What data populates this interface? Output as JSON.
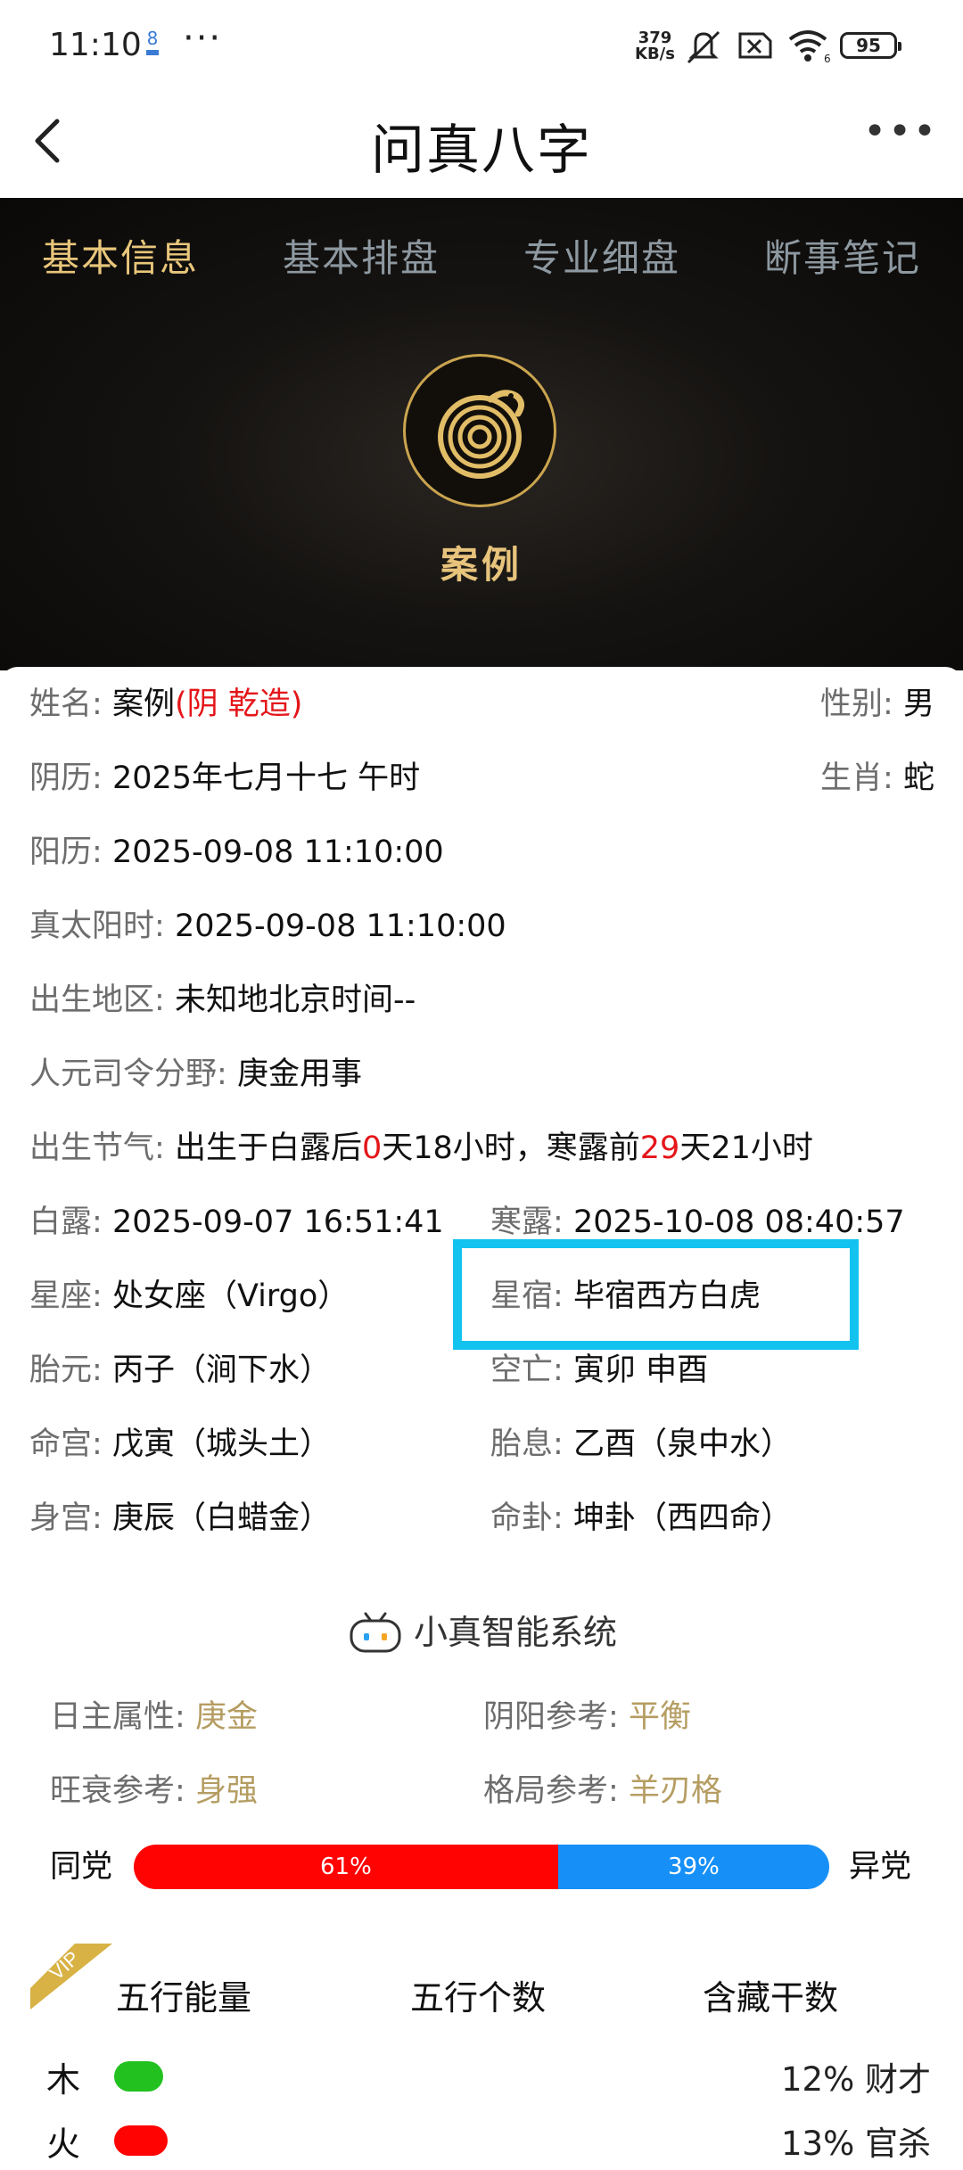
{
  "status_bar": {
    "time": "11:10",
    "notif_count": "8",
    "net_speed_value": "379",
    "net_speed_unit": "KB/s",
    "battery": "95",
    "icons": [
      "mute-icon",
      "sim-off-icon",
      "wifi-icon"
    ]
  },
  "header": {
    "title": "问真八字",
    "back_icon": "chevron-left-icon",
    "more_icon": "more-dots-icon"
  },
  "tabs": [
    "基本信息",
    "基本排盘",
    "专业细盘",
    "断事笔记"
  ],
  "active_tab": 0,
  "hero": {
    "name": "案例",
    "avatar_icon": "snake-zodiac-icon"
  },
  "basic": {
    "name_label": "姓名:",
    "name_value": "案例",
    "name_note": "(阴 乾造)",
    "gender_label": "性别:",
    "gender_value": "男",
    "lunar_label": "阴历:",
    "lunar_value": "2025年七月十七 午时",
    "zodiac_label": "生肖:",
    "zodiac_value": "蛇",
    "solar_label": "阳历:",
    "solar_value": "2025-09-08 11:10:00",
    "true_solar_label": "真太阳时:",
    "true_solar_value": "2025-09-08 11:10:00",
    "birthplace_label": "出生地区:",
    "birthplace_value": "未知地北京时间--",
    "siling_label": "人元司令分野:",
    "siling_value": "庚金用事",
    "jieqi_label": "出生节气:",
    "jieqi_p1": "出生于白露后",
    "jieqi_n1": "0",
    "jieqi_p2": "天18小时，寒露前",
    "jieqi_n2": "29",
    "jieqi_p3": "天21小时",
    "bailu_label": "白露:",
    "bailu_value": "2025-09-07 16:51:41",
    "hanlu_label": "寒露:",
    "hanlu_value": "2025-10-08 08:40:57",
    "xingzuo_label": "星座:",
    "xingzuo_value": "处女座（Virgo）",
    "xingxiu_label": "星宿:",
    "xingxiu_value": "毕宿西方白虎",
    "taiyuan_label": "胎元:",
    "taiyuan_value": "丙子（涧下水）",
    "kongwang_label": "空亡:",
    "kongwang_value": "寅卯 申酉",
    "minggong_label": "命宫:",
    "minggong_value": "戊寅（城头土）",
    "taixi_label": "胎息:",
    "taixi_value": "乙酉（泉中水）",
    "shengong_label": "身宫:",
    "shengong_value": "庚辰（白蜡金）",
    "minggua_label": "命卦:",
    "minggua_value": "坤卦（西四命）"
  },
  "ai": {
    "title": "小真智能系统",
    "robot_icon": "robot-icon",
    "rizhu_label": "日主属性:",
    "rizhu_value": "庚金",
    "yinyang_label": "阴阳参考:",
    "yinyang_value": "平衡",
    "wangshuai_label": "旺衰参考:",
    "wangshuai_value": "身强",
    "geju_label": "格局参考:",
    "geju_value": "羊刃格",
    "same_label": "同党",
    "diff_label": "异党",
    "same_pct_text": "61%",
    "diff_pct_text": "39%",
    "same_fraction": 0.61,
    "colors": {
      "same": "#ff0202",
      "diff": "#1690f7"
    }
  },
  "wuxing": {
    "vip_badge": "VIP",
    "tabs": [
      "五行能量",
      "五行个数",
      "含藏干数"
    ],
    "rows": [
      {
        "element": "木",
        "value": "12% 财才",
        "fraction": 0.12,
        "color": "#22c11f"
      },
      {
        "element": "火",
        "value": "13% 官杀",
        "fraction": 0.13,
        "color": "#ff0202"
      }
    ]
  }
}
